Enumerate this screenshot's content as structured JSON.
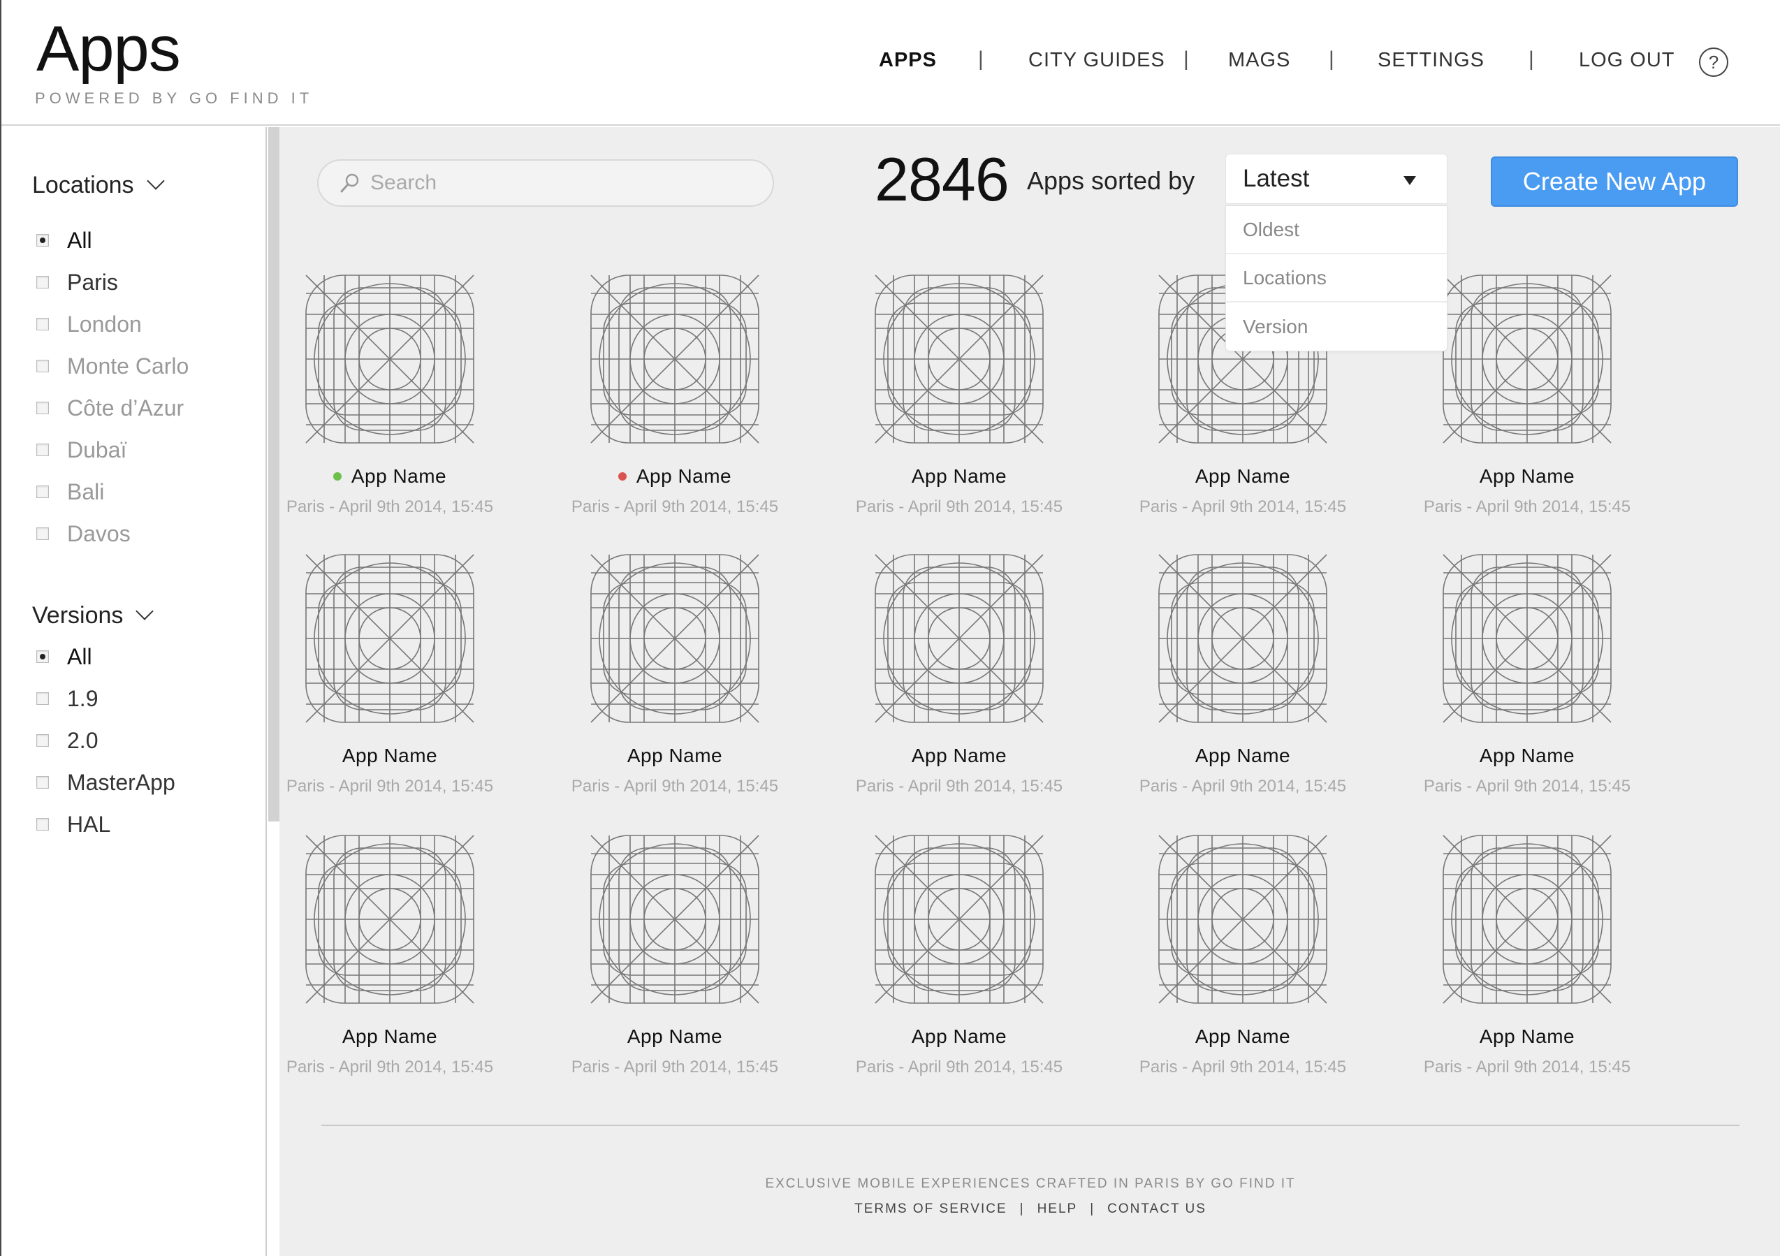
{
  "header": {
    "title": "Apps",
    "subtitle": "POWERED BY GO FIND IT",
    "nav": [
      "APPS",
      "CITY GUIDES",
      "MAGS",
      "SETTINGS",
      "LOG OUT"
    ],
    "help_glyph": "?"
  },
  "sidebar": {
    "locations": {
      "title": "Locations",
      "items": [
        {
          "label": "All",
          "checked": true
        },
        {
          "label": "Paris",
          "checked": false
        },
        {
          "label": "London",
          "checked": false
        },
        {
          "label": "Monte Carlo",
          "checked": false
        },
        {
          "label": "Côte d’Azur",
          "checked": false
        },
        {
          "label": "Dubaï",
          "checked": false
        },
        {
          "label": "Bali",
          "checked": false
        },
        {
          "label": "Davos",
          "checked": false
        }
      ]
    },
    "versions": {
      "title": "Versions",
      "items": [
        {
          "label": "All",
          "checked": true
        },
        {
          "label": "1.9",
          "checked": false
        },
        {
          "label": "2.0",
          "checked": false
        },
        {
          "label": "MasterApp",
          "checked": false
        },
        {
          "label": "HAL",
          "checked": false
        }
      ]
    }
  },
  "toolbar": {
    "search_placeholder": "Search",
    "count": "2846",
    "sorted_label": "Apps sorted by",
    "sort_selected": "Latest",
    "sort_options": [
      "Oldest",
      "Locations",
      "Version"
    ],
    "create_label": "Create New App"
  },
  "apps": [
    {
      "name": "App Name",
      "meta": "Paris - April 9th 2014, 15:45",
      "status": "green"
    },
    {
      "name": "App Name",
      "meta": "Paris - April 9th 2014, 15:45",
      "status": "red"
    },
    {
      "name": "App Name",
      "meta": "Paris - April 9th 2014, 15:45",
      "status": null
    },
    {
      "name": "App Name",
      "meta": "Paris - April 9th 2014, 15:45",
      "status": null
    },
    {
      "name": "App Name",
      "meta": "Paris - April 9th 2014, 15:45",
      "status": null
    },
    {
      "name": "App Name",
      "meta": "Paris - April 9th 2014, 15:45",
      "status": null
    },
    {
      "name": "App Name",
      "meta": "Paris - April 9th 2014, 15:45",
      "status": null
    },
    {
      "name": "App Name",
      "meta": "Paris - April 9th 2014, 15:45",
      "status": null
    },
    {
      "name": "App Name",
      "meta": "Paris - April 9th 2014, 15:45",
      "status": null
    },
    {
      "name": "App Name",
      "meta": "Paris - April 9th 2014, 15:45",
      "status": null
    },
    {
      "name": "App Name",
      "meta": "Paris - April 9th 2014, 15:45",
      "status": null
    },
    {
      "name": "App Name",
      "meta": "Paris - April 9th 2014, 15:45",
      "status": null
    },
    {
      "name": "App Name",
      "meta": "Paris - April 9th 2014, 15:45",
      "status": null
    },
    {
      "name": "App Name",
      "meta": "Paris - April 9th 2014, 15:45",
      "status": null
    },
    {
      "name": "App Name",
      "meta": "Paris - April 9th 2014, 15:45",
      "status": null
    }
  ],
  "status_colors": {
    "green": "#6cc04a",
    "red": "#d9534f"
  },
  "accent_color": "#4a9cf2",
  "footer": {
    "tagline": "EXCLUSIVE MOBILE EXPERIENCES CRAFTED IN PARIS  BY GO FIND IT",
    "links": [
      "TERMS OF SERVICE",
      "HELP",
      "CONTACT US"
    ]
  }
}
